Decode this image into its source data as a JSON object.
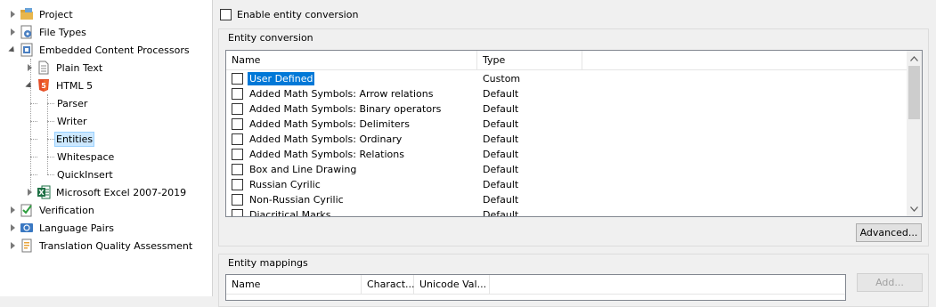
{
  "tree": {
    "items": [
      {
        "label": "Project"
      },
      {
        "label": "File Types"
      },
      {
        "label": "Embedded Content Processors"
      },
      {
        "label": "Plain Text"
      },
      {
        "label": "HTML 5"
      },
      {
        "label": "Parser"
      },
      {
        "label": "Writer"
      },
      {
        "label": "Entities"
      },
      {
        "label": "Whitespace"
      },
      {
        "label": "QuickInsert"
      },
      {
        "label": "Microsoft Excel 2007-2019"
      },
      {
        "label": "Verification"
      },
      {
        "label": "Language Pairs"
      },
      {
        "label": "Translation Quality Assessment"
      }
    ]
  },
  "settings": {
    "enable_label": "Enable entity conversion",
    "enable_checked": false
  },
  "entity_conversion": {
    "title": "Entity conversion",
    "columns": [
      "Name",
      "Type"
    ],
    "rows": [
      {
        "name": "User Defined",
        "type": "Custom"
      },
      {
        "name": "Added Math Symbols: Arrow relations",
        "type": "Default"
      },
      {
        "name": "Added Math Symbols: Binary operators",
        "type": "Default"
      },
      {
        "name": "Added Math Symbols: Delimiters",
        "type": "Default"
      },
      {
        "name": "Added Math Symbols: Ordinary",
        "type": "Default"
      },
      {
        "name": "Added Math Symbols: Relations",
        "type": "Default"
      },
      {
        "name": "Box and Line Drawing",
        "type": "Default"
      },
      {
        "name": "Russian Cyrilic",
        "type": "Default"
      },
      {
        "name": "Non-Russian Cyrilic",
        "type": "Default"
      },
      {
        "name": "Diacritical Marks",
        "type": "Default"
      }
    ],
    "advanced_label": "Advanced..."
  },
  "entity_mappings": {
    "title": "Entity mappings",
    "columns": [
      "Name",
      "Charact...",
      "Unicode Val..."
    ],
    "add_label": "Add..."
  }
}
